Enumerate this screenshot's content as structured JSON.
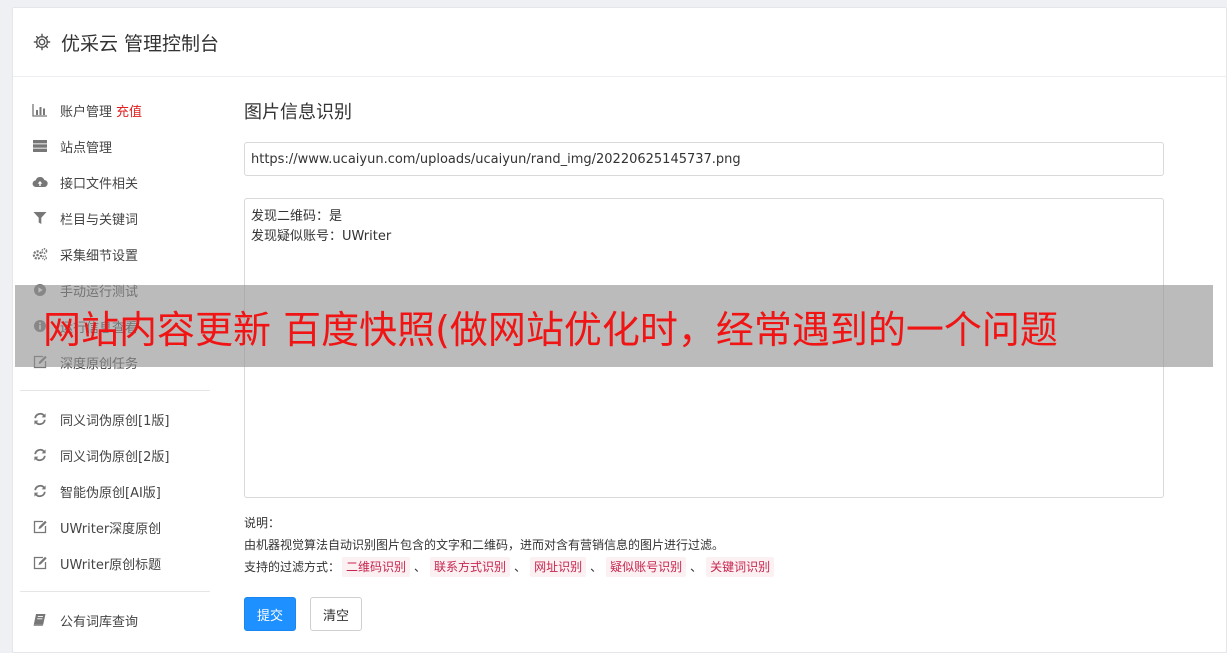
{
  "header": {
    "title": "优采云 管理控制台",
    "icon": "gear-icon"
  },
  "sidebar": {
    "group1": [
      {
        "label": "账户管理",
        "tag": "充值",
        "icon": "bar-chart-icon"
      },
      {
        "label": "站点管理",
        "icon": "server-icon"
      },
      {
        "label": "接口文件相关",
        "icon": "cloud-upload-icon"
      },
      {
        "label": "栏目与关键词",
        "icon": "filter-icon"
      },
      {
        "label": "采集细节设置",
        "icon": "cogs-icon"
      },
      {
        "label": "手动运行测试",
        "icon": "play-circle-icon"
      },
      {
        "label": "运行信息查看",
        "icon": "info-icon"
      },
      {
        "label": "深度原创任务",
        "icon": "edit-icon"
      }
    ],
    "group2": [
      {
        "label": "同义词伪原创[1版]",
        "icon": "refresh-icon"
      },
      {
        "label": "同义词伪原创[2版]",
        "icon": "refresh-icon"
      },
      {
        "label": "智能伪原创[AI版]",
        "icon": "refresh-icon"
      },
      {
        "label": "UWriter深度原创",
        "icon": "edit-icon"
      },
      {
        "label": "UWriter原创标题",
        "icon": "edit-icon"
      }
    ],
    "group3": [
      {
        "label": "公有词库查询",
        "icon": "book-icon"
      }
    ]
  },
  "main": {
    "title": "图片信息识别",
    "url_value": "https://www.ucaiyun.com/uploads/ucaiyun/rand_img/20220625145737.png",
    "result_lines": [
      "发现二维码：是",
      "发现疑似账号：UWriter"
    ],
    "notes_label": "说明：",
    "notes_text": "由机器视觉算法自动识别图片包含的文字和二维码，进而对含有营销信息的图片进行过滤。",
    "filter_label": "支持的过滤方式：",
    "filters": [
      "二维码识别",
      "联系方式识别",
      "网址识别",
      "疑似账号识别",
      "关键词识别"
    ],
    "filter_separator": "、",
    "submit_label": "提交",
    "clear_label": "清空"
  },
  "overlay": {
    "text": "网站内容更新 百度快照(做网站优化时，经常遇到的一个问题"
  },
  "colors": {
    "primary": "#1e90ff",
    "danger": "#e02020",
    "chip_text": "#c7254e",
    "chip_bg": "#fbf0f2"
  }
}
